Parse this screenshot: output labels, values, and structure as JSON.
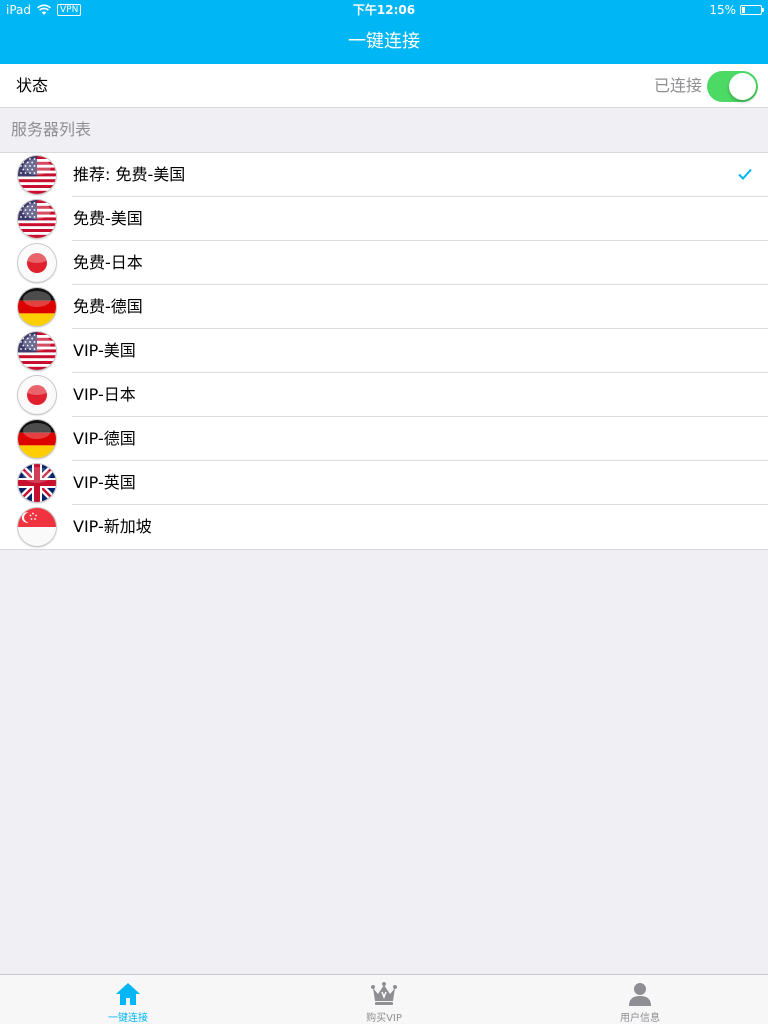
{
  "status_bar": {
    "device": "iPad",
    "vpn": "VPN",
    "time": "下午12:06",
    "battery": "15%",
    "battery_level": 0.15
  },
  "nav": {
    "title": "一键连接"
  },
  "connection": {
    "label": "状态",
    "status_text": "已连接",
    "toggle_on": true
  },
  "server_list": {
    "header": "服务器列表",
    "items": [
      {
        "label": "推荐: 免费-美国",
        "flag": "us-flag-icon",
        "selected": true
      },
      {
        "label": "免费-美国",
        "flag": "us-flag-icon",
        "selected": false
      },
      {
        "label": "免费-日本",
        "flag": "jp-flag-icon",
        "selected": false
      },
      {
        "label": "免费-德国",
        "flag": "de-flag-icon",
        "selected": false
      },
      {
        "label": "VIP-美国",
        "flag": "us-flag-icon",
        "selected": false
      },
      {
        "label": "VIP-日本",
        "flag": "jp-flag-icon",
        "selected": false
      },
      {
        "label": "VIP-德国",
        "flag": "de-flag-icon",
        "selected": false
      },
      {
        "label": "VIP-英国",
        "flag": "uk-flag-icon",
        "selected": false
      },
      {
        "label": "VIP-新加坡",
        "flag": "sg-flag-icon",
        "selected": false
      }
    ]
  },
  "tabbar": {
    "tabs": [
      {
        "label": "一键连接",
        "icon": "home-icon",
        "active": true
      },
      {
        "label": "购买VIP",
        "icon": "crown-icon",
        "active": false
      },
      {
        "label": "用户信息",
        "icon": "user-icon",
        "active": false
      }
    ]
  },
  "colors": {
    "accent": "#00b6f5",
    "toggle_on": "#4cd964",
    "background": "#efeff4",
    "secondary_text": "#8e8e93"
  }
}
